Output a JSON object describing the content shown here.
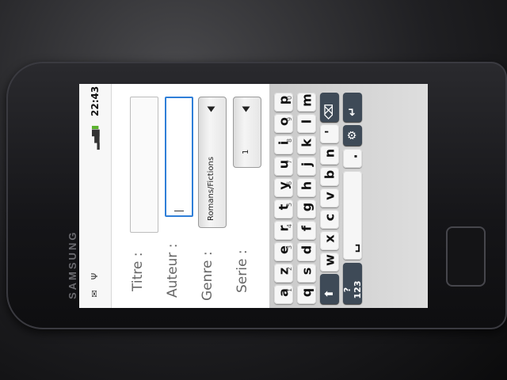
{
  "status_bar": {
    "time": "22:43",
    "icons": [
      "message-icon",
      "usb-icon",
      "battery-icon",
      "signal-icon"
    ]
  },
  "form": {
    "title_label": "Titre :",
    "author_label": "Auteur :",
    "genre_label": "Genre :",
    "series_label": "Serie :",
    "genre_value": "Romans/Fictions",
    "series_value": "1"
  },
  "device": {
    "brand": "SAMSUNG"
  },
  "keyboard": {
    "row1": [
      {
        "k": "a",
        "n": "1"
      },
      {
        "k": "z",
        "n": "2"
      },
      {
        "k": "e",
        "n": "3"
      },
      {
        "k": "r",
        "n": "4"
      },
      {
        "k": "t",
        "n": "5"
      },
      {
        "k": "y",
        "n": "6"
      },
      {
        "k": "u",
        "n": "7"
      },
      {
        "k": "i",
        "n": "8"
      },
      {
        "k": "o",
        "n": "9"
      },
      {
        "k": "p",
        "n": "0"
      }
    ],
    "row2": [
      "q",
      "s",
      "d",
      "f",
      "g",
      "h",
      "j",
      "k",
      "l",
      "m"
    ],
    "row3": [
      "w",
      "x",
      "c",
      "v",
      "b",
      "n",
      "'"
    ],
    "shift": "⬆",
    "backspace": "⌫",
    "symbols": "?123",
    "space": "␣",
    "period": ".",
    "enter": "↵",
    "settings": "⚙"
  }
}
